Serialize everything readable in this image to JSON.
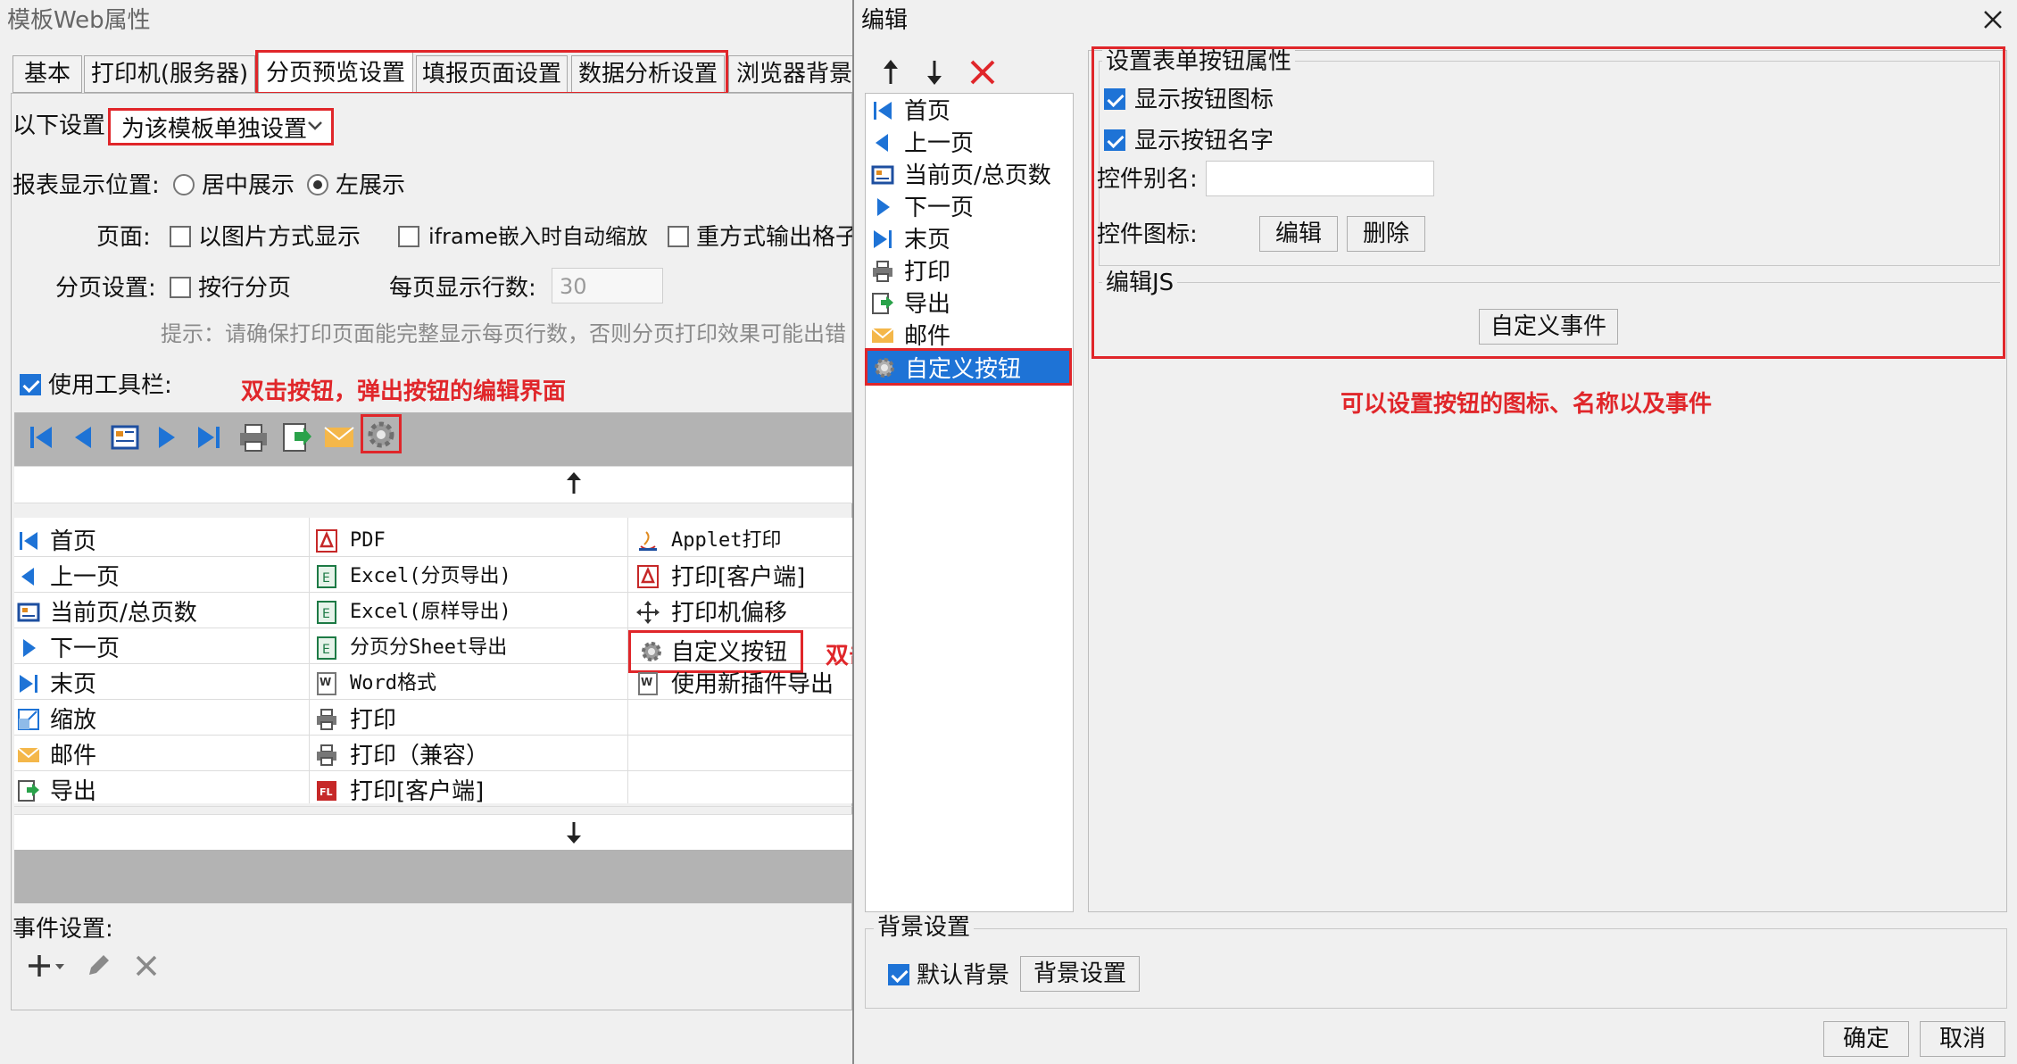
{
  "left_window": {
    "title": "模板Web属性",
    "tabs": [
      "基本",
      "打印机(服务器)",
      "分页预览设置",
      "填报页面设置",
      "数据分析设置",
      "浏览器背景"
    ],
    "setting_label": "以下设置:",
    "setting_select": "为该模板单独设置",
    "position_label": "报表显示位置:",
    "position_options": [
      "居中展示",
      "左展示"
    ],
    "page_label": "页面:",
    "page_options": [
      "以图片方式显示",
      "iframe嵌入时自动缩放",
      "重方式输出格子"
    ],
    "paging_label": "分页设置:",
    "paging_option": "按行分页",
    "rows_label": "每页显示行数:",
    "rows_value": "30",
    "hint": "提示：请确保打印页面能完整显示每页行数，否则分页打印效果可能出错",
    "toolbar_label": "使用工具栏:",
    "annotation_toolbar": "双击按钮，弹出按钮的编辑界面",
    "annotation_custom": "双击自定义按钮",
    "button_grid": {
      "col1": [
        "首页",
        "上一页",
        "当前页/总页数",
        "下一页",
        "末页",
        "缩放",
        "邮件",
        "导出"
      ],
      "col2": [
        "PDF",
        "Excel(分页导出)",
        "Excel(原样导出)",
        "分页分Sheet导出",
        "Word格式",
        "打印",
        "打印（兼容）",
        "打印[客户端]"
      ],
      "col3": [
        "Applet打印",
        "打印[客户端]",
        "打印机偏移",
        "自定义按钮",
        "使用新插件导出"
      ]
    },
    "events_label": "事件设置:"
  },
  "right_window": {
    "title": "编辑",
    "list_items": [
      "首页",
      "上一页",
      "当前页/总页数",
      "下一页",
      "末页",
      "打印",
      "导出",
      "邮件",
      "自定义按钮"
    ],
    "group_title": "设置表单按钮属性",
    "show_icon": "显示按钮图标",
    "show_name": "显示按钮名字",
    "alias_label": "控件别名:",
    "alias_value": "",
    "icon_label": "控件图标:",
    "edit_button": "编辑",
    "delete_button": "删除",
    "js_group": "编辑JS",
    "custom_event_button": "自定义事件",
    "annotation": "可以设置按钮的图标、名称以及事件",
    "bg_group": "背景设置",
    "default_bg": "默认背景",
    "bg_button": "背景设置",
    "ok_button": "确定",
    "cancel_button": "取消"
  }
}
